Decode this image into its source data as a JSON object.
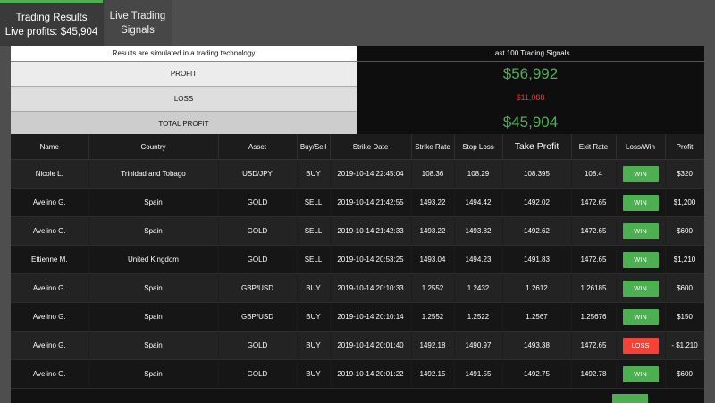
{
  "tabs": [
    {
      "line1": "Trading Results",
      "line2": "Live profits: $45,904"
    },
    {
      "line1": "Live Trading",
      "line2": "Signals"
    }
  ],
  "summary": {
    "left_header": "Results are simulated in a trading technology",
    "right_header": "Last 100 Trading Signals",
    "profit_label": "PROFIT",
    "loss_label": "LOSS",
    "total_label": "TOTAL PROFIT",
    "profit_value": "$56,992",
    "loss_value": "$11,088",
    "total_value": "$45,904"
  },
  "colors": {
    "win": "#4caf50",
    "loss": "#f44336",
    "accent": "#4caf50"
  },
  "table": {
    "headers": [
      "Name",
      "Country",
      "Asset",
      "Buy/Sell",
      "Strike Date",
      "Strike Rate",
      "Stop Loss",
      "Take Profit",
      "Exit Rate",
      "Loss/Win",
      "Profit"
    ],
    "rows": [
      [
        "Nicole L.",
        "Trinidad and Tobago",
        "USD/JPY",
        "BUY",
        "2019-10-14 22:45:04",
        "108.36",
        "108.29",
        "108.395",
        "108.4",
        "WIN",
        "$320"
      ],
      [
        "Avelino G.",
        "Spain",
        "GOLD",
        "SELL",
        "2019-10-14 21:42:55",
        "1493.22",
        "1494.42",
        "1492.02",
        "1472.65",
        "WIN",
        "$1,200"
      ],
      [
        "Avelino G.",
        "Spain",
        "GOLD",
        "SELL",
        "2019-10-14 21:42:33",
        "1493.22",
        "1493.82",
        "1492.62",
        "1472.65",
        "WIN",
        "$600"
      ],
      [
        "Ettienne M.",
        "United Kingdom",
        "GOLD",
        "SELL",
        "2019-10-14 20:53:25",
        "1493.04",
        "1494.23",
        "1491.83",
        "1472.65",
        "WIN",
        "$1,210"
      ],
      [
        "Avelino G.",
        "Spain",
        "GBP/USD",
        "BUY",
        "2019-10-14 20:10:33",
        "1.2552",
        "1.2432",
        "1.2612",
        "1.26185",
        "WIN",
        "$600"
      ],
      [
        "Avelino G.",
        "Spain",
        "GBP/USD",
        "BUY",
        "2019-10-14 20:10:14",
        "1.2552",
        "1.2522",
        "1.2567",
        "1.25676",
        "WIN",
        "$150"
      ],
      [
        "Avelino G.",
        "Spain",
        "GOLD",
        "BUY",
        "2019-10-14 20:01:40",
        "1492.18",
        "1490.97",
        "1493.38",
        "1472.65",
        "LOSS",
        "- $1,210"
      ],
      [
        "Avelino G.",
        "Spain",
        "GOLD",
        "BUY",
        "2019-10-14 20:01:22",
        "1492.15",
        "1491.55",
        "1492.75",
        "1492.78",
        "WIN",
        "$600"
      ]
    ]
  }
}
